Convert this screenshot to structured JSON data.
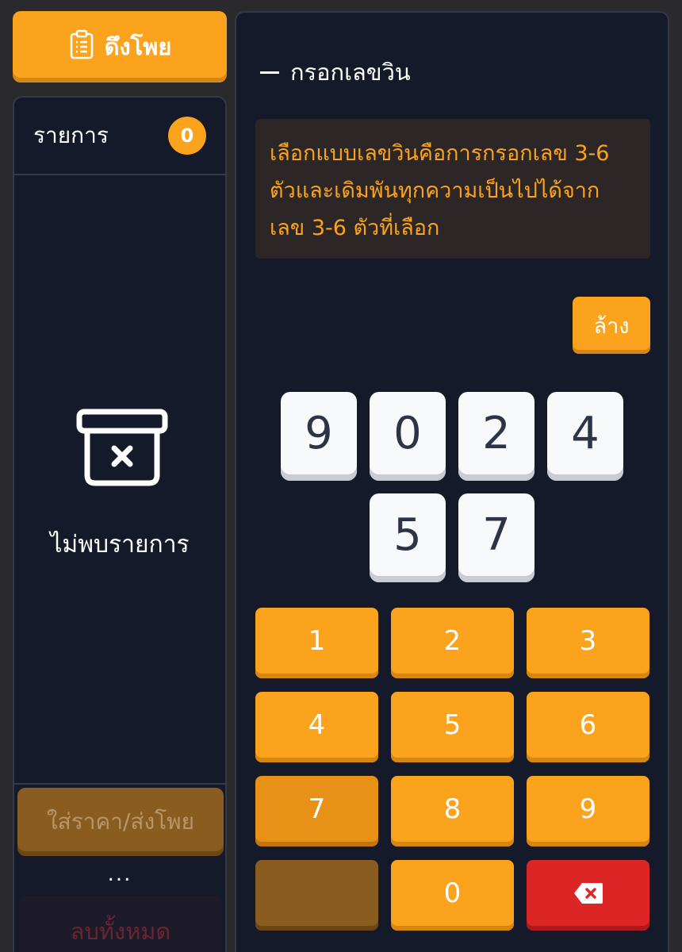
{
  "pull_button": {
    "label": "ดึงโพย",
    "icon": "clipboard-icon"
  },
  "list": {
    "title": "รายการ",
    "count": "0",
    "empty_text": "ไม่พบรายการ",
    "empty_icon": "empty-box-icon",
    "submit_label": "ใส่ราคา/ส่งโพย",
    "more_label": "...",
    "delete_all_label": "ลบทั้งหมด"
  },
  "main": {
    "section_title": "กรอกเลขวิน",
    "info_lines": [
      "เลือกแบบเลขวินคือการกรอกเลข 3-6",
      "ตัวและเดิมพันทุกความเป็นไปได้จาก",
      "เลข 3-6 ตัวที่เลือก"
    ],
    "clear_label": "ล้าง",
    "selected_digits": [
      "9",
      "0",
      "2",
      "4",
      "5",
      "7"
    ],
    "keypad": {
      "keys": [
        "1",
        "2",
        "3",
        "4",
        "5",
        "6",
        "7",
        "8",
        "9",
        "",
        "0"
      ],
      "backspace_icon": "backspace-icon"
    }
  },
  "colors": {
    "accent": "#fba31c",
    "panel_bg": "#151a2b",
    "page_bg": "#2a2a2c",
    "danger": "#dc2626",
    "info_text": "#fba31c"
  }
}
